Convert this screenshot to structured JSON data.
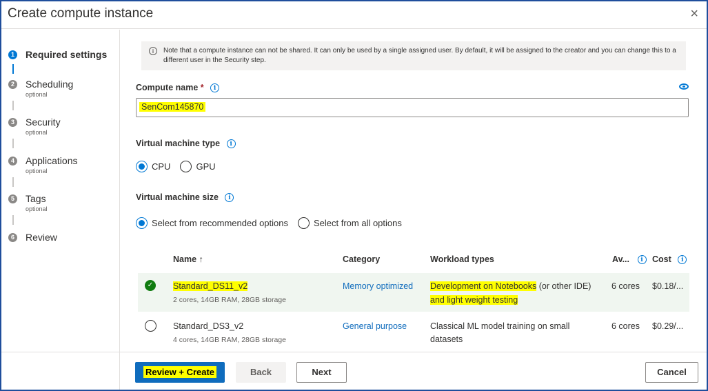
{
  "dialog": {
    "title": "Create compute instance",
    "close_icon": "×"
  },
  "sidebar": {
    "steps": [
      {
        "number": "1",
        "label": "Required settings",
        "sub": ""
      },
      {
        "number": "2",
        "label": "Scheduling",
        "sub": "optional"
      },
      {
        "number": "3",
        "label": "Security",
        "sub": "optional"
      },
      {
        "number": "4",
        "label": "Applications",
        "sub": "optional"
      },
      {
        "number": "5",
        "label": "Tags",
        "sub": "optional"
      },
      {
        "number": "6",
        "label": "Review",
        "sub": ""
      }
    ]
  },
  "info": {
    "icon": "i",
    "text": "Note that a compute instance can not be shared. It can only be used by a single assigned user. By default, it will be assigned to the creator and you can change this to a different user in the Security step."
  },
  "compute_name": {
    "label": "Compute name",
    "required": "*",
    "value": "SenCom145870"
  },
  "vm_type": {
    "label": "Virtual machine type",
    "options": [
      "CPU",
      "GPU"
    ],
    "selected": "CPU"
  },
  "vm_size": {
    "label": "Virtual machine size",
    "options": [
      "Select from recommended options",
      "Select from all options"
    ],
    "selected": "Select from recommended options"
  },
  "table": {
    "columns": [
      "Name ↑",
      "Category",
      "Workload types",
      "Av...",
      "Cost"
    ],
    "rows": [
      {
        "name": "Standard_DS11_v2",
        "specs": "2 cores, 14GB RAM, 28GB storage",
        "category": "Memory optimized",
        "workload_highlighted": "Development on Notebooks",
        "workload_rest": " (or other IDE)",
        "workload_line2": "and light weight testing",
        "available": "6 cores",
        "cost": "$0.18/...",
        "selected": true
      },
      {
        "name": "Standard_DS3_v2",
        "specs": "4 cores, 14GB RAM, 28GB storage",
        "category": "General purpose",
        "workload_line1": "Classical ML model training on small",
        "workload_line2": "datasets",
        "available": "6 cores",
        "cost": "$0.29/...",
        "selected": false
      }
    ]
  },
  "footer": {
    "review_create": "Review + Create",
    "back": "Back",
    "next": "Next",
    "cancel": "Cancel"
  },
  "colors": {
    "accent": "#0f6cbd",
    "highlight": "#ffff00",
    "selected_check": "#107c10"
  }
}
